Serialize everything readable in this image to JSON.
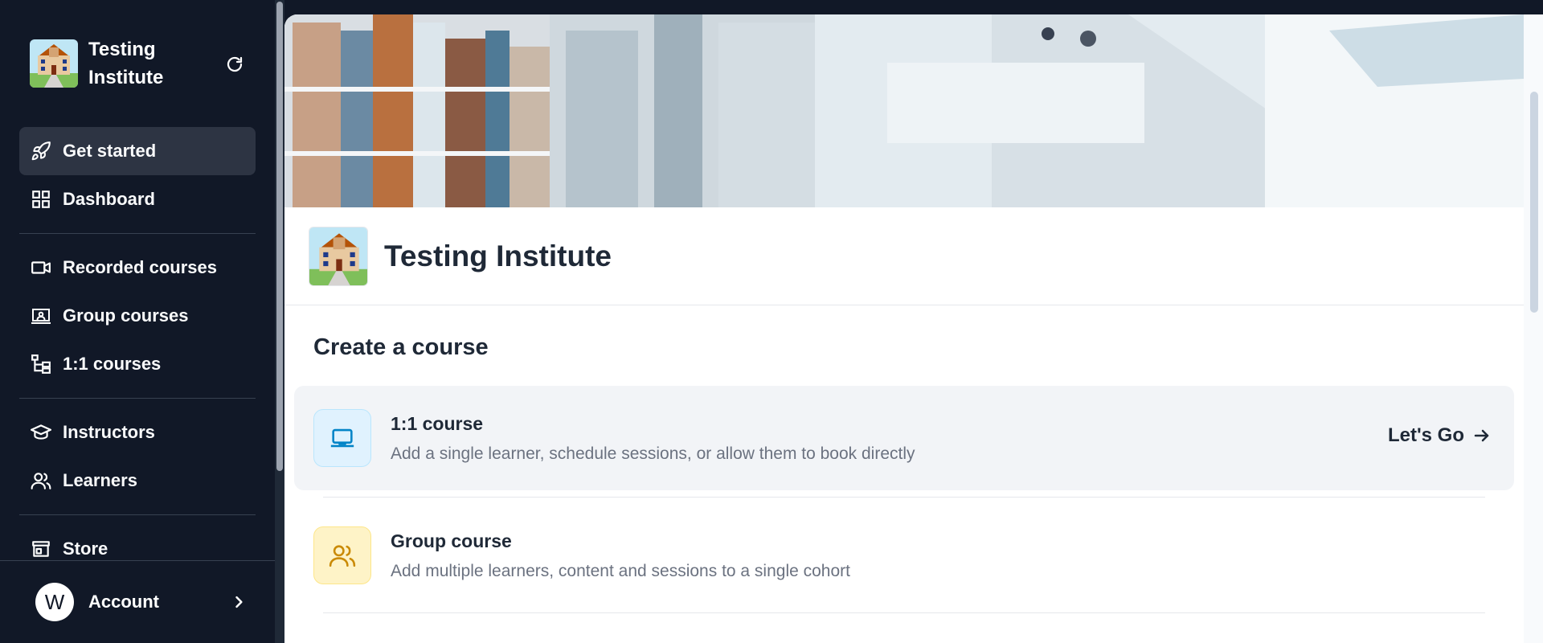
{
  "sidebar": {
    "brand_name": "Testing Institute",
    "items": [
      {
        "label": "Get started",
        "icon": "rocket-icon",
        "active": true
      },
      {
        "label": "Dashboard",
        "icon": "grid-icon"
      },
      {
        "label": "Recorded courses",
        "icon": "video-icon"
      },
      {
        "label": "Group courses",
        "icon": "presentation-icon"
      },
      {
        "label": "1:1 courses",
        "icon": "hierarchy-icon"
      },
      {
        "label": "Instructors",
        "icon": "graduation-cap-icon"
      },
      {
        "label": "Learners",
        "icon": "users-icon"
      },
      {
        "label": "Store",
        "icon": "store-icon"
      }
    ],
    "account": {
      "avatar_initial": "W",
      "label": "Account"
    }
  },
  "main": {
    "institute_name": "Testing Institute",
    "section_title": "Create a course",
    "courses": [
      {
        "title": "1:1 course",
        "description": "Add a single learner, schedule sessions, or allow them to book directly",
        "action_label": "Let's Go",
        "icon": "laptop-icon"
      },
      {
        "title": "Group course",
        "description": "Add multiple learners, content and sessions to a single cohort",
        "icon": "users-icon"
      }
    ]
  },
  "colors": {
    "sidebar_bg": "#111827",
    "active_item_bg": "#2d3443",
    "card_highlight_bg": "#f2f4f7",
    "blue_icon": "#0284c7",
    "yellow_icon": "#ca8a04"
  }
}
